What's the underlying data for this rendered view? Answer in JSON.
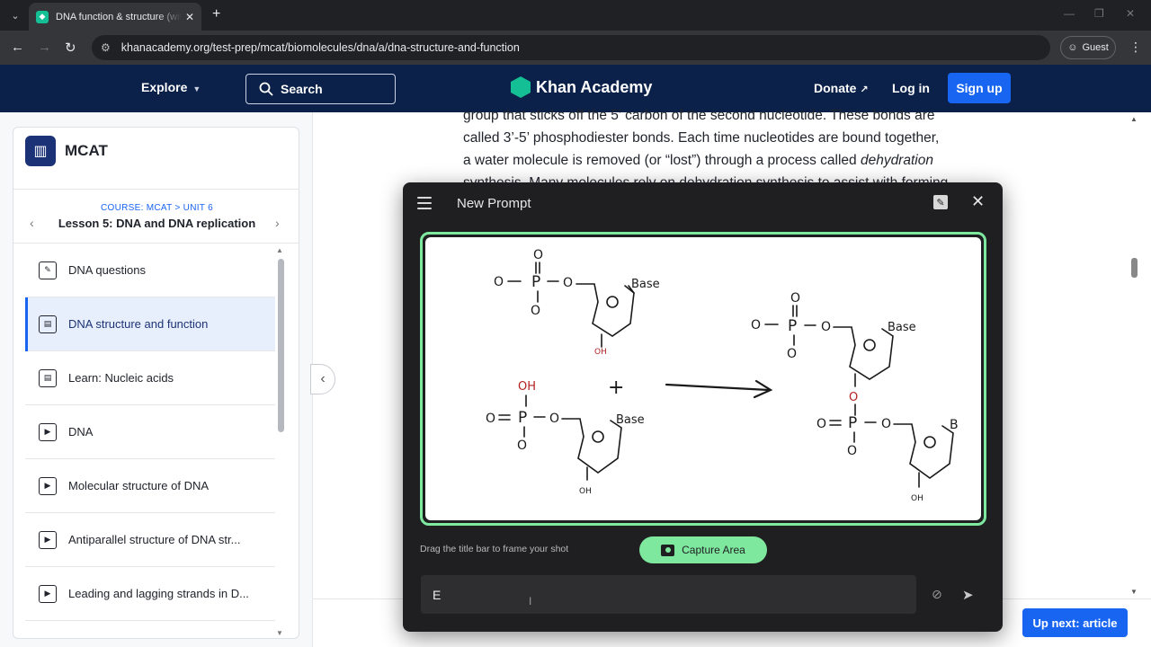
{
  "browser": {
    "tab_title": "DNA function & structure (with",
    "tab_close": "✕",
    "new_tab": "+",
    "url": "khanacademy.org/test-prep/mcat/biomolecules/dna/a/dna-structure-and-function",
    "profile_label": "Guest"
  },
  "header": {
    "explore_label": "Explore",
    "search_label": "Search",
    "logo_text": "Khan Academy",
    "donate_label": "Donate",
    "login_label": "Log in",
    "signup_label": "Sign up"
  },
  "sidebar": {
    "course_title": "MCAT",
    "breadcrumb": "COURSE: MCAT > UNIT 6",
    "lesson_title": "Lesson 5: DNA and DNA replication",
    "items": [
      {
        "label": "DNA questions",
        "type": "exercise",
        "active": false
      },
      {
        "label": "DNA structure and function",
        "type": "article",
        "active": true
      },
      {
        "label": "Learn: Nucleic acids",
        "type": "article",
        "active": false
      },
      {
        "label": "DNA",
        "type": "video",
        "active": false
      },
      {
        "label": "Molecular structure of DNA",
        "type": "video",
        "active": false
      },
      {
        "label": "Antiparallel structure of DNA str...",
        "type": "video",
        "active": false
      },
      {
        "label": "Leading and lagging strands in D...",
        "type": "video",
        "active": false
      }
    ]
  },
  "article": {
    "lines": [
      "group that sticks off the 5’ carbon of the second nucleotide. These bonds are",
      "called 3’-5’ phosphodiester bonds. Each time nucleotides are bound together,",
      "a water molecule is removed (or “lost”) through a process called"
    ],
    "italic_term": "dehydration",
    "partial_line": "synthesis. Many molecules rely on dehydration synthesis to assist with forming"
  },
  "up_next_label": "Up next: article",
  "dialog": {
    "title": "New Prompt",
    "hint": "Drag the title bar to frame your shot",
    "capture_label": "Capture Area",
    "input_value": "E",
    "drawing_labels": {
      "base": "Base",
      "base_short": "B",
      "oh": "OH",
      "oh_lower": "OH",
      "phosphorus": "P",
      "oxygen": "O",
      "plus": "+"
    }
  },
  "colors": {
    "ka_navy": "#0b2149",
    "ka_blue": "#1865f2",
    "ka_green": "#14bf96",
    "capture_green": "#7ee89f",
    "ink_red": "#b22222"
  }
}
